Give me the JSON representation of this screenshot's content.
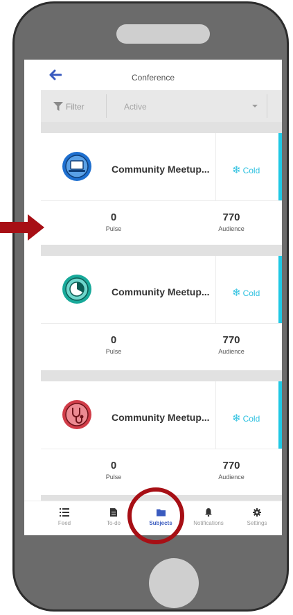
{
  "header": {
    "title": "Conference"
  },
  "filter": {
    "label": "Filter",
    "value": "Active"
  },
  "cards": [
    {
      "name": "Community Meetup...",
      "status": "Cold",
      "icon": "laptop-icon",
      "color": "#1e6fcf",
      "pulse_value": "0",
      "pulse_label": "Pulse",
      "audience_value": "770",
      "audience_label": "Audience"
    },
    {
      "name": "Community Meetup...",
      "status": "Cold",
      "icon": "pie-chart-icon",
      "color": "#18a99a",
      "pulse_value": "0",
      "pulse_label": "Pulse",
      "audience_value": "770",
      "audience_label": "Audience"
    },
    {
      "name": "Community Meetup...",
      "status": "Cold",
      "icon": "stethoscope-icon",
      "color": "#d13c48",
      "pulse_value": "0",
      "pulse_label": "Pulse",
      "audience_value": "770",
      "audience_label": "Audience"
    }
  ],
  "tabs": [
    {
      "label": "Feed",
      "icon": "list-icon"
    },
    {
      "label": "To-do",
      "icon": "document-icon"
    },
    {
      "label": "Subjects",
      "icon": "folder-icon",
      "active": true
    },
    {
      "label": "Notifications",
      "icon": "bell-icon"
    },
    {
      "label": "Settings",
      "icon": "gear-icon"
    }
  ],
  "colors": {
    "accent": "#1fc8e4",
    "status": "#2ec1e0",
    "active_tab": "#3a5bbf",
    "highlight": "#a70f15"
  }
}
